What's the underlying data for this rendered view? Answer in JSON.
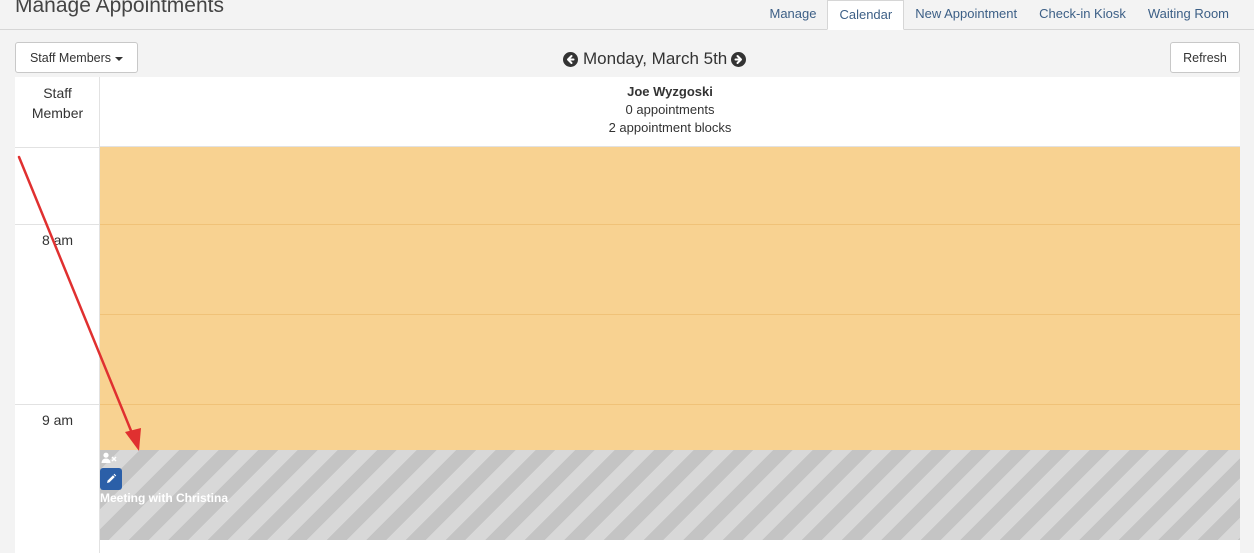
{
  "header": {
    "title": "Manage Appointments",
    "tabs": [
      {
        "label": "Manage"
      },
      {
        "label": "Calendar"
      },
      {
        "label": "New Appointment"
      },
      {
        "label": "Check-in Kiosk"
      },
      {
        "label": "Waiting Room"
      }
    ]
  },
  "toolbar": {
    "staff_members_label": "Staff Members",
    "date_label": "Monday, March 5th",
    "refresh_label": "Refresh"
  },
  "calendar": {
    "staff_column_header": "Staff\nMember",
    "staff_column_line1": "Staff",
    "staff_column_line2": "Member",
    "times": [
      "8 am",
      "9 am"
    ],
    "staff": {
      "name": "Joe Wyzgoski",
      "appointments": "0 appointments",
      "blocks": "2 appointment blocks"
    },
    "block": {
      "title": "Meeting with Christina"
    }
  },
  "colors": {
    "available_block": "#f8d291",
    "busy_block": "#c4c4c4",
    "edit_button": "#2b5fa8",
    "annotation_arrow": "#e03030"
  }
}
